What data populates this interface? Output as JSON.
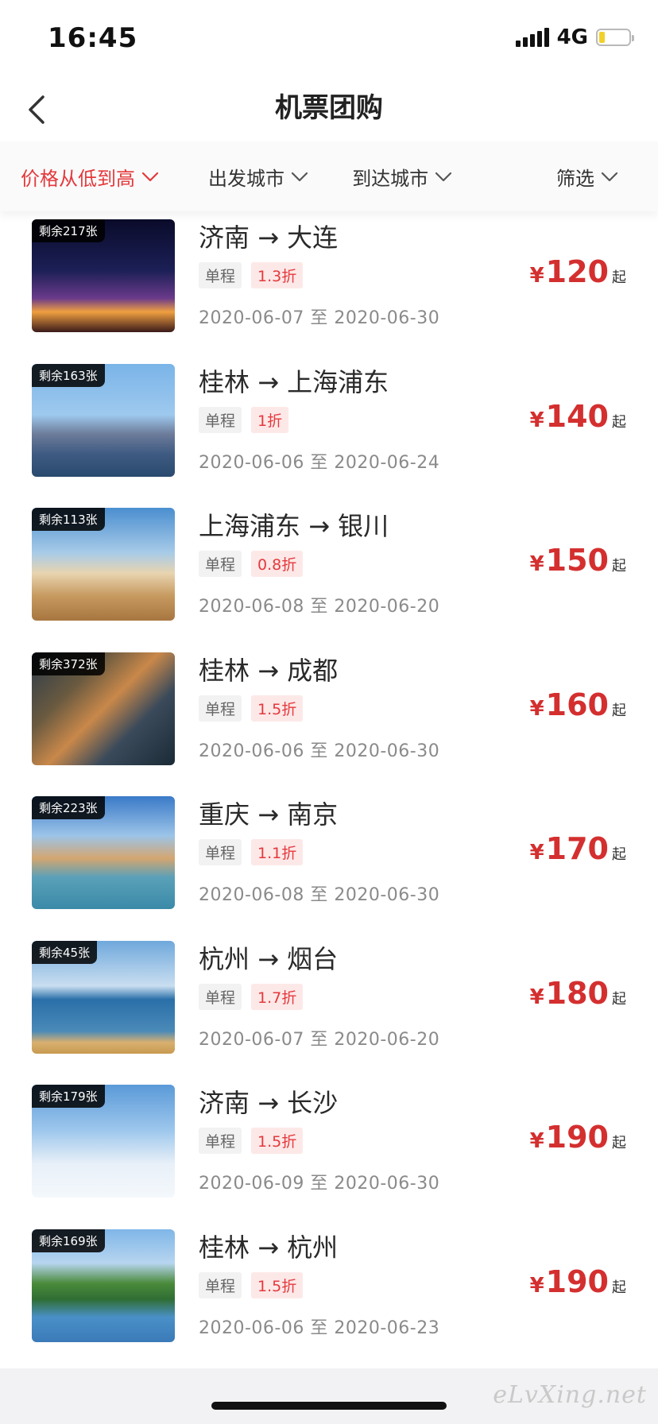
{
  "status_bar": {
    "time": "16:45",
    "network": "4G",
    "battery_level": 0.2
  },
  "nav": {
    "title": "机票团购",
    "back_icon": "chevron-left-icon"
  },
  "filters": [
    {
      "label": "价格从低到高",
      "active": true
    },
    {
      "label": "出发城市",
      "active": false
    },
    {
      "label": "到达城市",
      "active": false
    },
    {
      "label": "筛选",
      "active": false
    }
  ],
  "colors": {
    "accent": "#e4393c",
    "price": "#d42f2f"
  },
  "flights": [
    {
      "remaining": "剩余217张",
      "from": "济南",
      "to": "大连",
      "type": "单程",
      "discount": "1.3折",
      "start": "2020-06-07",
      "sep": "至",
      "end": "2020-06-30",
      "currency": "¥",
      "price": "120",
      "suffix": "起"
    },
    {
      "remaining": "剩余163张",
      "from": "桂林",
      "to": "上海浦东",
      "type": "单程",
      "discount": "1折",
      "start": "2020-06-06",
      "sep": "至",
      "end": "2020-06-24",
      "currency": "¥",
      "price": "140",
      "suffix": "起"
    },
    {
      "remaining": "剩余113张",
      "from": "上海浦东",
      "to": "银川",
      "type": "单程",
      "discount": "0.8折",
      "start": "2020-06-08",
      "sep": "至",
      "end": "2020-06-20",
      "currency": "¥",
      "price": "150",
      "suffix": "起"
    },
    {
      "remaining": "剩余372张",
      "from": "桂林",
      "to": "成都",
      "type": "单程",
      "discount": "1.5折",
      "start": "2020-06-06",
      "sep": "至",
      "end": "2020-06-30",
      "currency": "¥",
      "price": "160",
      "suffix": "起"
    },
    {
      "remaining": "剩余223张",
      "from": "重庆",
      "to": "南京",
      "type": "单程",
      "discount": "1.1折",
      "start": "2020-06-08",
      "sep": "至",
      "end": "2020-06-30",
      "currency": "¥",
      "price": "170",
      "suffix": "起"
    },
    {
      "remaining": "剩余45张",
      "from": "杭州",
      "to": "烟台",
      "type": "单程",
      "discount": "1.7折",
      "start": "2020-06-07",
      "sep": "至",
      "end": "2020-06-20",
      "currency": "¥",
      "price": "180",
      "suffix": "起"
    },
    {
      "remaining": "剩余179张",
      "from": "济南",
      "to": "长沙",
      "type": "单程",
      "discount": "1.5折",
      "start": "2020-06-09",
      "sep": "至",
      "end": "2020-06-30",
      "currency": "¥",
      "price": "190",
      "suffix": "起"
    },
    {
      "remaining": "剩余169张",
      "from": "桂林",
      "to": "杭州",
      "type": "单程",
      "discount": "1.5折",
      "start": "2020-06-06",
      "sep": "至",
      "end": "2020-06-23",
      "currency": "¥",
      "price": "190",
      "suffix": "起"
    }
  ],
  "watermark": "eLvXing.net"
}
